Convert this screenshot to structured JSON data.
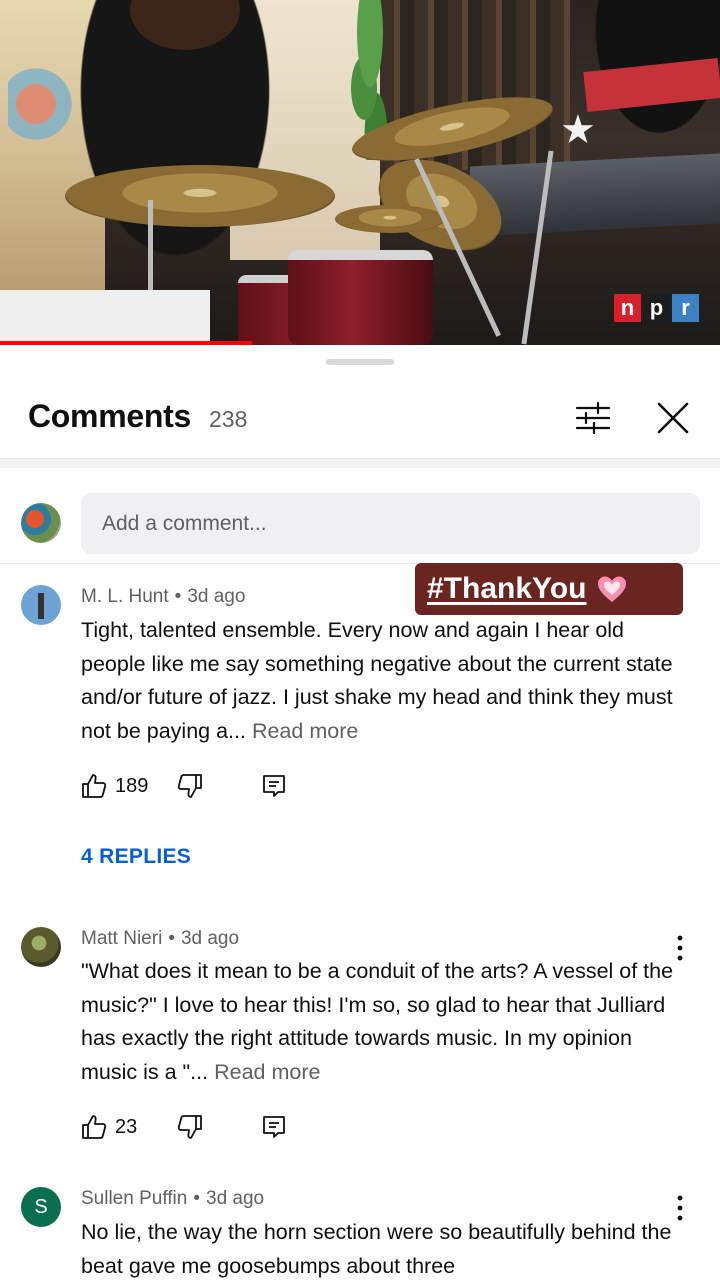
{
  "video": {
    "brand_letters": [
      "n",
      "p",
      "r"
    ],
    "progress_fraction": 0.35
  },
  "comments_header": {
    "title": "Comments",
    "count": "238"
  },
  "add_comment": {
    "placeholder": "Add a comment..."
  },
  "sticker": {
    "text": "#ThankYou"
  },
  "comments": [
    {
      "author": "M. L. Hunt",
      "age": "3d ago",
      "text": "Tight, talented ensemble. Every now and again I hear old people like me say something negative about the current state and/or future of jazz. I just shake my head and think they must not be paying a...",
      "read_more": "Read more",
      "likes": "189",
      "replies": "4 REPLIES"
    },
    {
      "author": "Matt Nieri",
      "age": "3d ago",
      "text": "\"What does it mean to be a conduit of the arts? A vessel of the music?\" I love to hear this! I'm so, so glad to hear that Julliard has exactly the right attitude towards music. In my opinion music is a \"...",
      "read_more": "Read more",
      "likes": "23"
    },
    {
      "author": "Sullen Puffin",
      "avatar_letter": "S",
      "age": "3d ago",
      "text": "No lie, the way the horn section were so beautifully behind the beat gave me goosebumps about three"
    }
  ],
  "meta_separator": "•",
  "colors": {
    "link_blue": "#065fd4",
    "progress_red": "#ff0000",
    "sticker_bg": "#6a2520"
  },
  "icons": [
    "filter-icon",
    "close-icon",
    "thumbs-up-icon",
    "thumbs-down-icon",
    "reply-icon",
    "more-vert-icon",
    "heart-icon"
  ]
}
